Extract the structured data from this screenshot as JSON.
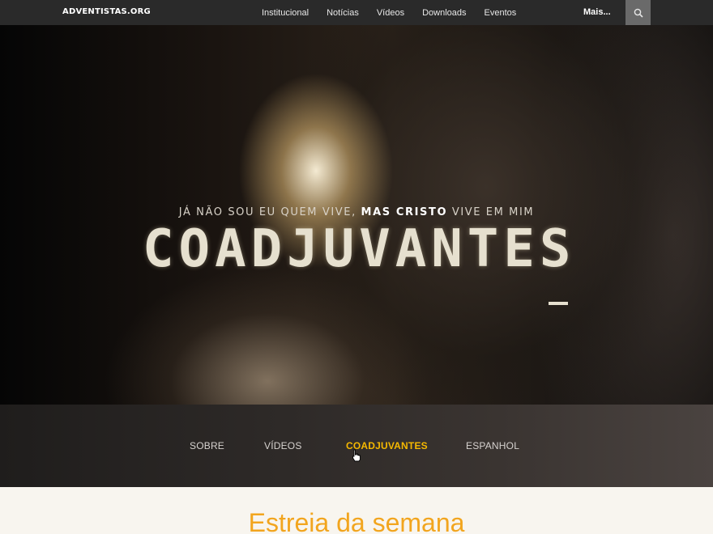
{
  "header": {
    "logo": "ADVENTISTAS.ORG",
    "nav": [
      "Institucional",
      "Notícias",
      "Vídeos",
      "Downloads",
      "Eventos"
    ],
    "more": "Mais...",
    "search_icon": "search-icon"
  },
  "hero": {
    "tagline_part1": "JÁ NÃO SOU EU QUEM VIVE,",
    "tagline_bold": "MAS CRISTO",
    "tagline_part2": "VIVE EM MIM",
    "title": "COADJUVANTES"
  },
  "subnav": {
    "items": [
      "SOBRE",
      "VÍDEOS",
      "COADJUVANTES",
      "ESPANHOL"
    ],
    "active": "COADJUVANTES"
  },
  "section": {
    "title": "Estreia da semana"
  },
  "colors": {
    "accent": "#f5b800",
    "section_title": "#f2a51e",
    "topbar": "#2a2a2a"
  }
}
